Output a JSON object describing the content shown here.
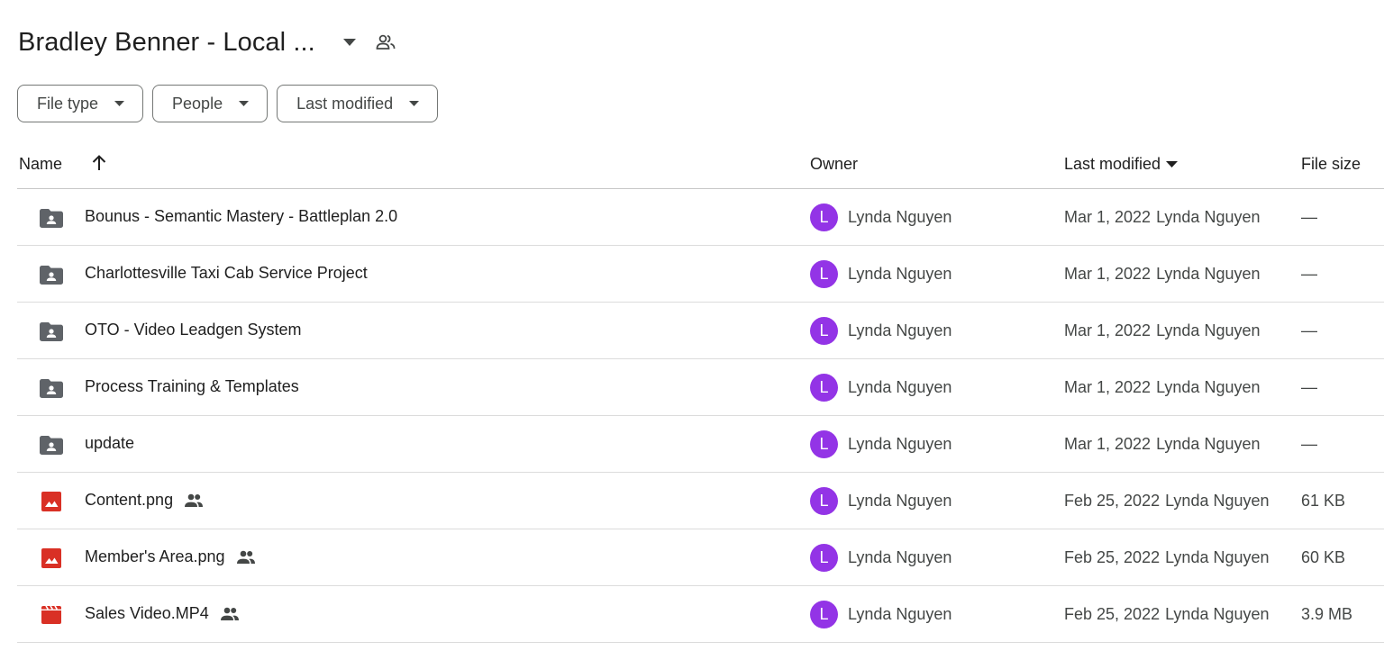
{
  "title": "Bradley Benner - Local ...",
  "filters": {
    "file_type": "File type",
    "people": "People",
    "last_modified": "Last modified"
  },
  "columns": {
    "name": "Name",
    "owner": "Owner",
    "last_modified": "Last modified",
    "file_size": "File size"
  },
  "rows": [
    {
      "name": "Bounus - Semantic Mastery - Battleplan 2.0",
      "icon": "shared-folder-icon",
      "shared": false,
      "avatar": "L",
      "owner": "Lynda Nguyen",
      "modified_date": "Mar 1, 2022",
      "modified_by": "Lynda Nguyen",
      "size": "—"
    },
    {
      "name": "Charlottesville Taxi Cab Service Project",
      "icon": "shared-folder-icon",
      "shared": false,
      "avatar": "L",
      "owner": "Lynda Nguyen",
      "modified_date": "Mar 1, 2022",
      "modified_by": "Lynda Nguyen",
      "size": "—"
    },
    {
      "name": "OTO - Video Leadgen System",
      "icon": "shared-folder-icon",
      "shared": false,
      "avatar": "L",
      "owner": "Lynda Nguyen",
      "modified_date": "Mar 1, 2022",
      "modified_by": "Lynda Nguyen",
      "size": "—"
    },
    {
      "name": "Process Training & Templates",
      "icon": "shared-folder-icon",
      "shared": false,
      "avatar": "L",
      "owner": "Lynda Nguyen",
      "modified_date": "Mar 1, 2022",
      "modified_by": "Lynda Nguyen",
      "size": "—"
    },
    {
      "name": "update",
      "icon": "shared-folder-icon",
      "shared": false,
      "avatar": "L",
      "owner": "Lynda Nguyen",
      "modified_date": "Mar 1, 2022",
      "modified_by": "Lynda Nguyen",
      "size": "—"
    },
    {
      "name": "Content.png",
      "icon": "image-file-icon",
      "shared": true,
      "avatar": "L",
      "owner": "Lynda Nguyen",
      "modified_date": "Feb 25, 2022",
      "modified_by": "Lynda Nguyen",
      "size": "61 KB"
    },
    {
      "name": "Member's Area.png",
      "icon": "image-file-icon",
      "shared": true,
      "avatar": "L",
      "owner": "Lynda Nguyen",
      "modified_date": "Feb 25, 2022",
      "modified_by": "Lynda Nguyen",
      "size": "60 KB"
    },
    {
      "name": "Sales Video.MP4",
      "icon": "video-file-icon",
      "shared": true,
      "avatar": "L",
      "owner": "Lynda Nguyen",
      "modified_date": "Feb 25, 2022",
      "modified_by": "Lynda Nguyen",
      "size": "3.9 MB"
    }
  ],
  "colors": {
    "avatar": "#9334e6",
    "folder_icon": "#5f6368",
    "media_icon": "#d93025"
  }
}
